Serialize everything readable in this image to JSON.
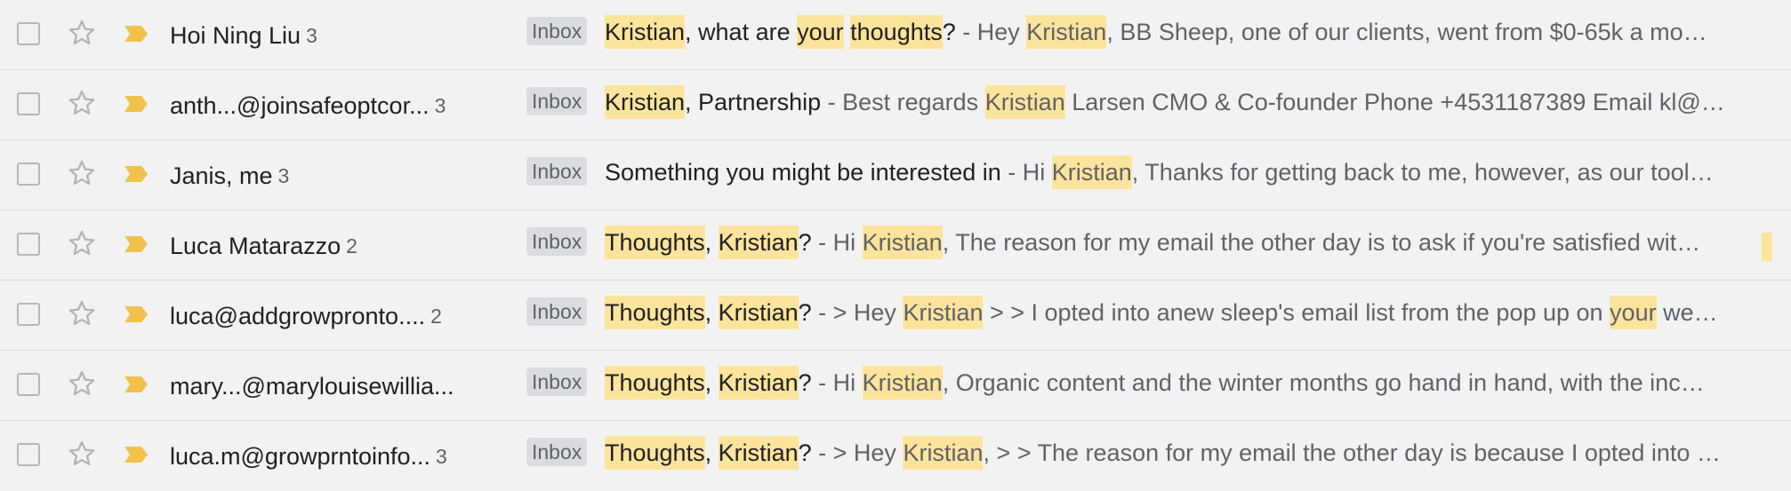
{
  "inbox_label": "Inbox",
  "colors": {
    "highlight": "#fde49c",
    "importance": "#f0c24a",
    "row_bg": "#f2f2f2"
  },
  "rows": [
    {
      "sender": "Hoi Ning Liu",
      "count": "3",
      "subject": [
        {
          "t": "Kristian",
          "hl": true
        },
        {
          "t": ", what are ",
          "hl": false
        },
        {
          "t": "your",
          "hl": true
        },
        {
          "t": " ",
          "hl": false
        },
        {
          "t": "thoughts",
          "hl": true
        },
        {
          "t": "?",
          "hl": false
        }
      ],
      "snippet": [
        {
          "t": " - Hey ",
          "hl": false
        },
        {
          "t": "Kristian",
          "hl": true
        },
        {
          "t": ", BB Sheep, one of our clients, went from $0-65k a mo…",
          "hl": false
        }
      ]
    },
    {
      "sender": "anth...@joinsafeoptcor...",
      "count": "3",
      "subject": [
        {
          "t": "Kristian",
          "hl": true
        },
        {
          "t": ", Partnership",
          "hl": false
        }
      ],
      "snippet": [
        {
          "t": " - Best regards ",
          "hl": false
        },
        {
          "t": "Kristian",
          "hl": true
        },
        {
          "t": " Larsen CMO & Co-founder Phone +4531187389 Email kl@…",
          "hl": false
        }
      ]
    },
    {
      "sender": "Janis, me",
      "count": "3",
      "subject": [
        {
          "t": "Something you might be interested in",
          "hl": false
        }
      ],
      "snippet": [
        {
          "t": " - Hi ",
          "hl": false
        },
        {
          "t": "Kristian",
          "hl": true
        },
        {
          "t": ", Thanks for getting back to me, however, as our tool…",
          "hl": false
        }
      ]
    },
    {
      "sender": "Luca Matarazzo",
      "count": "2",
      "subject": [
        {
          "t": "Thoughts",
          "hl": true
        },
        {
          "t": ", ",
          "hl": false
        },
        {
          "t": "Kristian",
          "hl": true
        },
        {
          "t": "?",
          "hl": false
        }
      ],
      "snippet": [
        {
          "t": " - Hi ",
          "hl": false
        },
        {
          "t": "Kristian",
          "hl": true
        },
        {
          "t": ", The reason for my email the other day is to ask if you're satisfied wit…",
          "hl": false
        }
      ]
    },
    {
      "sender": "luca@addgrowpronto....",
      "count": "2",
      "subject": [
        {
          "t": "Thoughts",
          "hl": true
        },
        {
          "t": ", ",
          "hl": false
        },
        {
          "t": "Kristian",
          "hl": true
        },
        {
          "t": "?",
          "hl": false
        }
      ],
      "snippet": [
        {
          "t": " - > Hey ",
          "hl": false
        },
        {
          "t": "Kristian",
          "hl": true
        },
        {
          "t": " > > I opted into anew sleep's email list from the pop up on ",
          "hl": false
        },
        {
          "t": "your",
          "hl": true
        },
        {
          "t": " we…",
          "hl": false
        }
      ]
    },
    {
      "sender": "mary...@marylouisewillia...",
      "count": "",
      "subject": [
        {
          "t": "Thoughts",
          "hl": true
        },
        {
          "t": ", ",
          "hl": false
        },
        {
          "t": "Kristian",
          "hl": true
        },
        {
          "t": "?",
          "hl": false
        }
      ],
      "snippet": [
        {
          "t": " - Hi ",
          "hl": false
        },
        {
          "t": "Kristian",
          "hl": true
        },
        {
          "t": ", Organic content and the winter months go hand in hand, with the inc…",
          "hl": false
        }
      ]
    },
    {
      "sender": "luca.m@growprntoinfo...",
      "count": "3",
      "subject": [
        {
          "t": "Thoughts",
          "hl": true
        },
        {
          "t": ", ",
          "hl": false
        },
        {
          "t": "Kristian",
          "hl": true
        },
        {
          "t": "?",
          "hl": false
        }
      ],
      "snippet": [
        {
          "t": " - > Hey ",
          "hl": false
        },
        {
          "t": "Kristian",
          "hl": true
        },
        {
          "t": ", > > The reason for my email the other day is because I opted into …",
          "hl": false
        }
      ]
    }
  ]
}
